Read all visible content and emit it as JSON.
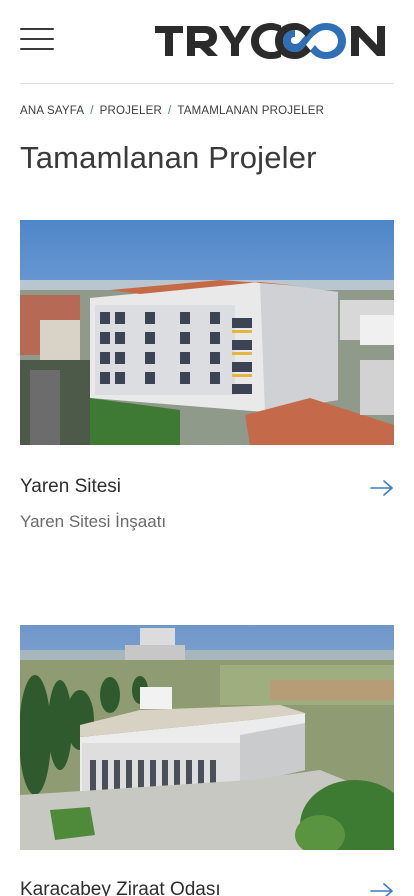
{
  "header": {
    "logo_text": "TRYCON",
    "menu_icon": "hamburger-menu-icon",
    "brand_dark": "#2b2b2b",
    "brand_blue": "#2f6fb6"
  },
  "breadcrumb": [
    {
      "label": "ANA SAYFA"
    },
    {
      "label": "PROJELER"
    },
    {
      "label": "TAMAMLANAN PROJELER"
    }
  ],
  "breadcrumb_separator": "/",
  "page": {
    "title": "Tamamlanan Projeler"
  },
  "projects": [
    {
      "title": "Yaren Sitesi",
      "subtitle": "Yaren Sitesi İnşaatı",
      "arrow_icon": "arrow-right-icon"
    },
    {
      "title": "Karacabey Ziraat Odası",
      "arrow_icon": "arrow-right-icon"
    }
  ],
  "accent_color": "#3b7dc4"
}
